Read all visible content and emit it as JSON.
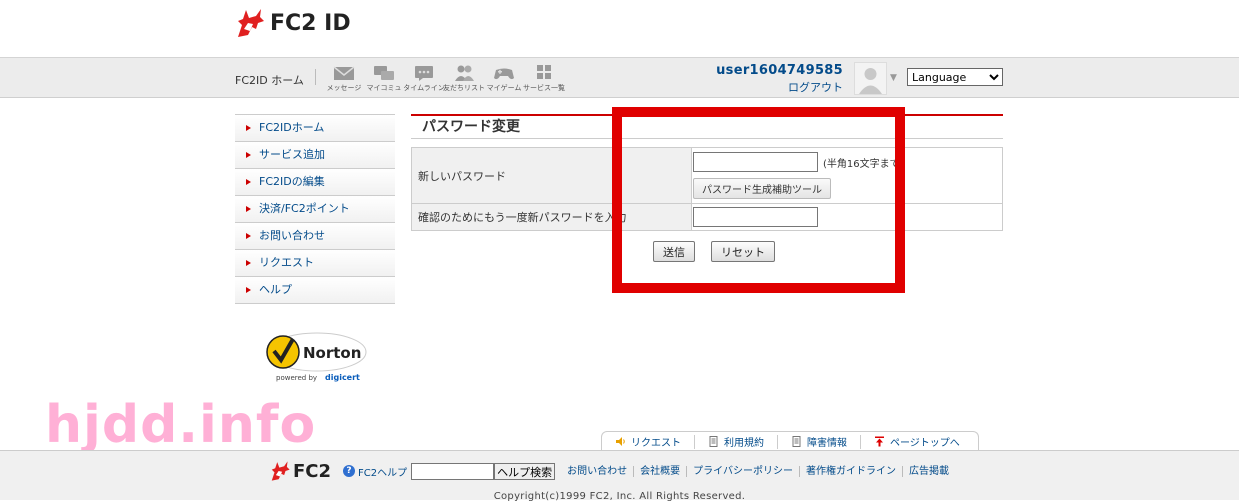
{
  "header": {
    "brand": "FC2 ID",
    "nav_home": "FC2ID ホーム",
    "nav_icons": [
      {
        "label": "メッセージ",
        "icon": "envelope-icon"
      },
      {
        "label": "マイコミュ",
        "icon": "chat-icon"
      },
      {
        "label": "タイムライン",
        "icon": "timeline-icon"
      },
      {
        "label": "友だちリスト",
        "icon": "friends-icon"
      },
      {
        "label": "マイゲーム",
        "icon": "gamepad-icon"
      },
      {
        "label": "サービス一覧",
        "icon": "grid-icon"
      }
    ],
    "username": "user1604749585",
    "logout": "ログアウト",
    "language": "Language"
  },
  "sidebar": {
    "items": [
      {
        "label": "FC2IDホーム"
      },
      {
        "label": "サービス追加"
      },
      {
        "label": "FC2IDの編集"
      },
      {
        "label": "決済/FC2ポイント"
      },
      {
        "label": "お問い合わせ"
      },
      {
        "label": "リクエスト"
      },
      {
        "label": "ヘルプ"
      }
    ],
    "badge": {
      "name": "Norton",
      "powered": "powered by",
      "vendor": "digicert"
    }
  },
  "form": {
    "title": "パスワード変更",
    "new_password_label": "新しいパスワード",
    "new_password_value": "",
    "new_password_hint": "(半角16文字まで)",
    "generator_button": "パスワード生成補助ツール",
    "confirm_label": "確認のためにもう一度新パスワードを入力",
    "confirm_value": "",
    "submit": "送信",
    "reset": "リセット"
  },
  "watermark": "hjdd.info",
  "footer": {
    "tabs": [
      {
        "label": "リクエスト",
        "icon": "speaker-icon"
      },
      {
        "label": "利用規約",
        "icon": "document-icon"
      },
      {
        "label": "障害情報",
        "icon": "document-icon"
      },
      {
        "label": "ページトップへ",
        "icon": "arrow-up-icon"
      }
    ],
    "brand": "FC2",
    "help": "FC2ヘルプ",
    "search_button": "ヘルプ検索",
    "links": [
      {
        "label": "お問い合わせ"
      },
      {
        "label": "会社概要"
      },
      {
        "label": "プライバシーポリシー"
      },
      {
        "label": "著作権ガイドライン"
      },
      {
        "label": "広告掲載"
      }
    ],
    "copyright": "Copyright(c)1999 FC2, Inc. All Rights Reserved."
  },
  "colors": {
    "accent": "#cc0000",
    "link": "#034b8a",
    "highlight": "#e00000",
    "watermark": "#ffb0d6"
  }
}
